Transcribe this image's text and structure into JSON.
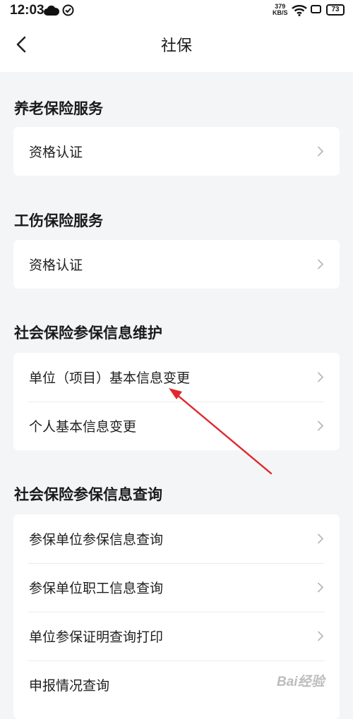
{
  "status_bar": {
    "time": "12:03",
    "net_speed_value": "379",
    "net_speed_unit": "KB/S",
    "battery": "73"
  },
  "nav": {
    "title": "社保"
  },
  "sections": [
    {
      "title": "养老保险服务",
      "items": [
        {
          "label": "资格认证"
        }
      ]
    },
    {
      "title": "工伤保险服务",
      "items": [
        {
          "label": "资格认证"
        }
      ]
    },
    {
      "title": "社会保险参保信息维护",
      "items": [
        {
          "label": "单位（项目）基本信息变更"
        },
        {
          "label": "个人基本信息变更"
        }
      ]
    },
    {
      "title": "社会保险参保信息查询",
      "items": [
        {
          "label": "参保单位参保信息查询"
        },
        {
          "label": "参保单位职工信息查询"
        },
        {
          "label": "单位参保证明查询打印"
        },
        {
          "label": "申报情况查询"
        }
      ]
    }
  ],
  "watermark": "Bai经验",
  "colors": {
    "background": "#f4f5f7",
    "card": "#ffffff",
    "annotation_arrow": "#e0282e"
  }
}
